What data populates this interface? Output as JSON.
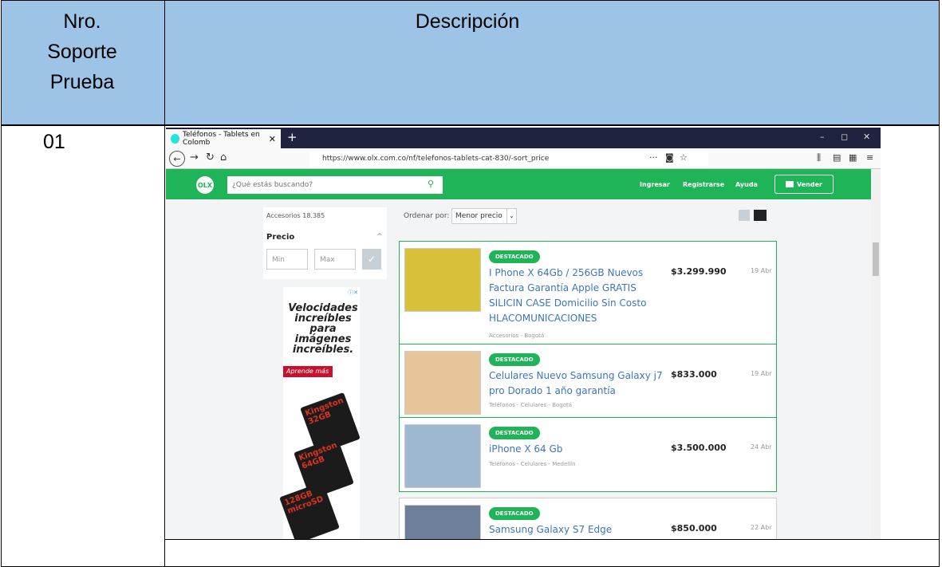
{
  "table": {
    "header_col1": [
      "Nro.",
      "Soporte",
      "Prueba"
    ],
    "header_col2": "Descripción",
    "row_number": "01"
  },
  "browser": {
    "tab_title": "Teléfonos - Tablets en Colomb",
    "tab_close": "✕",
    "new_tab": "+",
    "url": "https://www.olx.com.co/nf/telefonos-tablets-cat-830/-sort_price",
    "url_menu": "···",
    "window_controls": {
      "minimize": "–",
      "maximize": "◻",
      "close": "✕"
    }
  },
  "olx": {
    "logo": "OLX",
    "search_placeholder": "¿Qué estás buscando?",
    "nav": {
      "login": "Ingresar",
      "register": "Registrarse",
      "help": "Ayuda",
      "sell": "Vender"
    },
    "sidebar": {
      "category_count": "Accesorios 18.385",
      "price_label": "Precio",
      "min_placeholder": "Min",
      "max_placeholder": "Max"
    },
    "ad": {
      "text_lines": [
        "Velocidades",
        "increíbles",
        "para",
        "imágenes",
        "increíbles."
      ],
      "button": "Aprende más",
      "card_labels": [
        "Kingston 32GB",
        "Kingston 64GB",
        "128GB microSD"
      ]
    },
    "sort": {
      "label": "Ordenar por:",
      "value": "Menor precio"
    },
    "listings": [
      {
        "badge": "DESTACADO",
        "title": "I Phone X 64Gb / 256GB Nuevos Factura Garantía Apple GRATIS SILICIN CASE Domicilio Sin Costo HLACOMUNICACIONES",
        "price": "$3.299.990",
        "date": "19 Abr",
        "category": "Accesorios - Bogotá"
      },
      {
        "badge": "DESTACADO",
        "title": "Celulares Nuevo Samsung Galaxy j7 pro Dorado 1 año garantía",
        "price": "$833.000",
        "date": "19 Abr",
        "category": "Teléfonos - Celulares - Bogotá"
      },
      {
        "badge": "DESTACADO",
        "title": "iPhone X 64 Gb",
        "price": "$3.500.000",
        "date": "24 Abr",
        "category": "Teléfonos - Celulares - Medellín"
      },
      {
        "badge": "DESTACADO",
        "title": "Samsung Galaxy S7 Edge",
        "price": "$850.000",
        "date": "22 Abr",
        "category": ""
      }
    ]
  },
  "colors": {
    "header_bg": "#9dc3e6",
    "olx_green": "#1fb457",
    "tabbar": "#202340"
  }
}
